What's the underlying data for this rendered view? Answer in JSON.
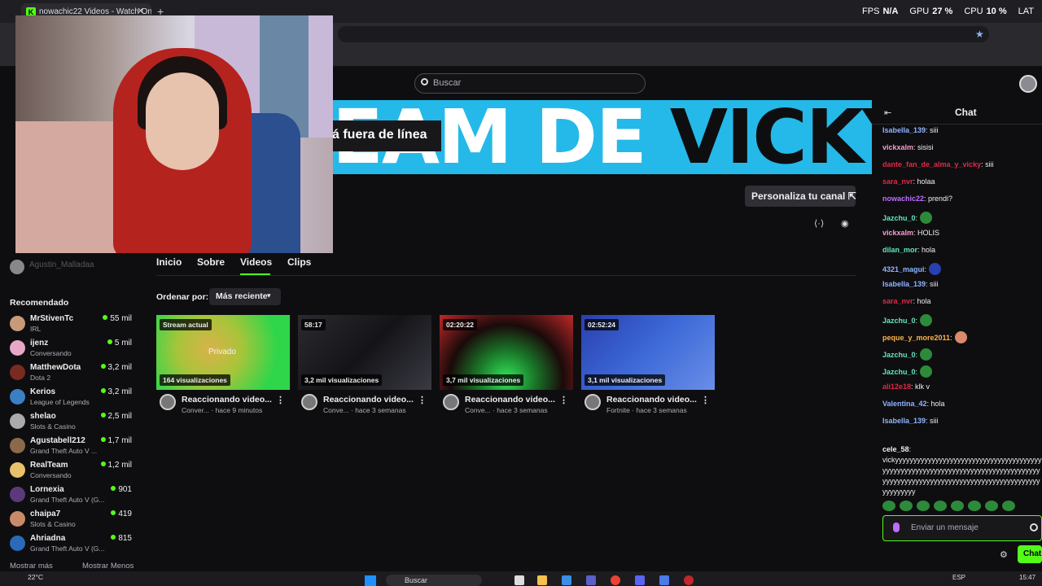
{
  "browser": {
    "tab_title": "nowachic22 Videos - Watch Onl",
    "tab_close": "✕",
    "tab_new": "+",
    "stats": [
      {
        "label": "FPS",
        "value": "N/A"
      },
      {
        "label": "GPU",
        "value": "27 %"
      },
      {
        "label": "CPU",
        "value": "10 %"
      },
      {
        "label": "LAT",
        "value": ""
      }
    ]
  },
  "site": {
    "search_placeholder": "Buscar"
  },
  "banner": {
    "text_light": "EAM DE ",
    "text_dark": "VICKY",
    "offline_text": "á fuera de línea",
    "customize_label": "Personaliza tu canal ⇱",
    "color": "#24b9e9"
  },
  "sidebar": {
    "user_name": "Agustin_Malladaa",
    "recommended_title": "Recomendado",
    "channels": [
      {
        "name": "MrStivenTc",
        "category": "IRL",
        "viewers": "55 mil",
        "color": "#c99a7a"
      },
      {
        "name": "ijenz",
        "category": "Conversando",
        "viewers": "5 mil",
        "color": "#e7a8c8"
      },
      {
        "name": "MatthewDota",
        "category": "Dota 2",
        "viewers": "3,2 mil",
        "color": "#7a2b20"
      },
      {
        "name": "Kerios",
        "category": "League of Legends",
        "viewers": "3,2 mil",
        "color": "#3b7fc4"
      },
      {
        "name": "shelao",
        "category": "Slots & Casino",
        "viewers": "2,5 mil",
        "color": "#aaaaaa"
      },
      {
        "name": "Agustabell212",
        "category": "Grand Theft Auto V ...",
        "viewers": "1,7 mil",
        "color": "#8a6a4a"
      },
      {
        "name": "RealTeam",
        "category": "Conversando",
        "viewers": "1,2 mil",
        "color": "#e8c26a"
      },
      {
        "name": "Lornexia",
        "category": "Grand Theft Auto V (G...",
        "viewers": "901",
        "color": "#5a3a7a"
      },
      {
        "name": "chaipa7",
        "category": "Slots & Casino",
        "viewers": "419",
        "color": "#c98a6a"
      },
      {
        "name": "Ahriadna",
        "category": "Grand Theft Auto V (G...",
        "viewers": "815",
        "color": "#2a6ab8"
      }
    ],
    "show_more": "Mostrar más",
    "show_less": "Mostrar Menos"
  },
  "channel_tabs": [
    "Inicio",
    "Sobre",
    "Videos",
    "Clips"
  ],
  "order": {
    "label": "Ordenar por:",
    "selected": "Más reciente"
  },
  "videos": [
    {
      "badge": "Stream actual",
      "views": "164 visualizaciones",
      "title": "Reaccionando video...",
      "meta": "Conver... · hace 9 minutos",
      "overlay": "Privado",
      "thumb": "radial-gradient(circle at 40% 45%, #d9b24a 0%, #a9c43a 35%, #2fd64a 75%)"
    },
    {
      "badge": "58:17",
      "views": "3,2 mil visualizaciones",
      "title": "Reaccionando video...",
      "meta": "Conve... · hace 3 semanas",
      "overlay": "",
      "thumb": "linear-gradient(135deg, #2a2a30 0%, #141418 50%, #3a3a44 100%)"
    },
    {
      "badge": "02:20:22",
      "views": "3,7 mil visualizaciones",
      "title": "Reaccionando video...",
      "meta": "Conve... · hace 3 semanas",
      "overlay": "",
      "thumb": "radial-gradient(ellipse at 50% 85%, #35e35a 0%, #1a7a2a 30%, #1a0a0a 60%, #c0282a 100%)"
    },
    {
      "badge": "02:52:24",
      "views": "3,1 mil visualizaciones",
      "title": "Reaccionando video...",
      "meta": "Fortnite · hace 3 semanas",
      "overlay": "",
      "thumb": "linear-gradient(135deg, #2a3fb0 0%, #3d6ad8 50%, #6a8ee8 100%)"
    }
  ],
  "chat": {
    "title": "Chat",
    "messages": [
      {
        "user": "Isabella_139",
        "color": "#8fb3ff",
        "text": ": siii",
        "emote": ""
      },
      {
        "user": "vickxalm",
        "color": "#ff9ad5",
        "text": ": sisisi",
        "emote": ""
      },
      {
        "user": "dante_fan_de_alma_y_vicky",
        "color": "#e0294a",
        "text": ": siii",
        "emote": ""
      },
      {
        "user": "sara_nvr",
        "color": "#e0294a",
        "text": ": holaa",
        "emote": ""
      },
      {
        "user": "nowachic22",
        "color": "#bf6cff",
        "text": ": prendi?",
        "emote": ""
      },
      {
        "user": "Jazchu_0",
        "color": "#63e6be",
        "text": ":",
        "emote": "#2d8a3a"
      },
      {
        "user": "vickxalm",
        "color": "#ff9ad5",
        "text": ": HOLIS",
        "emote": ""
      },
      {
        "user": "dilan_mor",
        "color": "#63e6be",
        "text": ": hola",
        "emote": ""
      },
      {
        "user": "4321_magui",
        "color": "#8fb3ff",
        "text": ":",
        "emote": "#2a3fb0"
      },
      {
        "user": "Isabella_139",
        "color": "#8fb3ff",
        "text": ": siii",
        "emote": ""
      },
      {
        "user": "sara_nvr",
        "color": "#e0294a",
        "text": ": hola",
        "emote": ""
      },
      {
        "user": "Jazchu_0",
        "color": "#63e6be",
        "text": ":",
        "emote": "#2d8a3a"
      },
      {
        "user": "peque_y_more2011",
        "color": "#ffb347",
        "text": ":",
        "emote": "#d98a6a"
      },
      {
        "user": "Jazchu_0",
        "color": "#63e6be",
        "text": ":",
        "emote": "#2d8a3a"
      },
      {
        "user": "Jazchu_0",
        "color": "#63e6be",
        "text": ":",
        "emote": "#2d8a3a"
      },
      {
        "user": "ali12e18",
        "color": "#e0294a",
        "text": ": klk v",
        "emote": ""
      },
      {
        "user": "Valentina_42",
        "color": "#8fb3ff",
        "text": ": hola",
        "emote": ""
      },
      {
        "user": "Isabella_139",
        "color": "#8fb3ff",
        "text": ": siii",
        "emote": ""
      }
    ],
    "long_user": "cele_58",
    "long_text": "vickyyyyyyyyyyyyyyyyyyyyyyyyyyyyyyyyyyyyyyyyyyyyyyyyyyyyyyyyyyyyyyyyyyyyyyyyyyyyyyyyyyyyyyyyyyyyyyyyyyyyyyyyyyyyyyyyyyyyyyyyyyyyyyyyyyyyyyy",
    "input_placeholder": "Enviar un mensaje",
    "send_label": "Chat",
    "accent": "#53fc18"
  },
  "taskbar": {
    "weather": "22°C",
    "search_label": "Buscar",
    "lang": "ESP",
    "clock": "15:47"
  }
}
